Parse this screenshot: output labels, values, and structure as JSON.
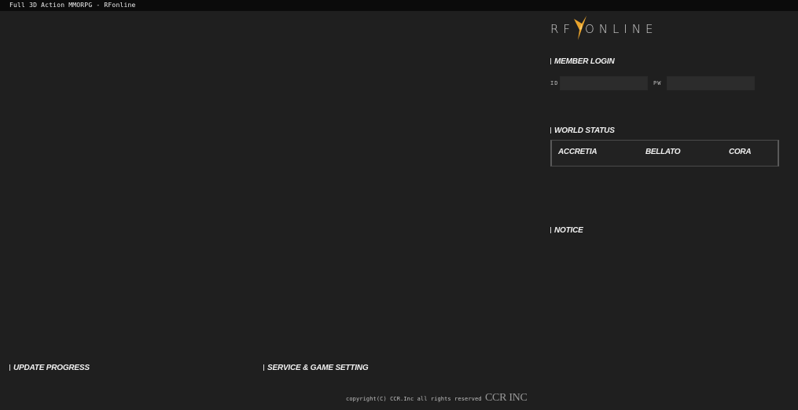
{
  "window": {
    "title": "Full 3D Action MMORPG - RFonline"
  },
  "logo": {
    "left_text": "RF",
    "right_text": "ONLINE",
    "accent_color": "#e8a32c"
  },
  "login": {
    "title": "MEMBER LOGIN",
    "id_label": "ID",
    "pw_label": "PW",
    "id_value": "",
    "pw_value": ""
  },
  "world_status": {
    "title": "WORLD STATUS",
    "races": [
      "ACCRETIA",
      "BELLATO",
      "CORA"
    ]
  },
  "notice": {
    "title": "NOTICE"
  },
  "update_progress": {
    "title": "UPDATE PROGRESS"
  },
  "service": {
    "title": "SERVICE & GAME SETTING"
  },
  "footer": {
    "copyright": "copyright(C) CCR.Inc all rights reserved",
    "company": "CCR INC"
  }
}
